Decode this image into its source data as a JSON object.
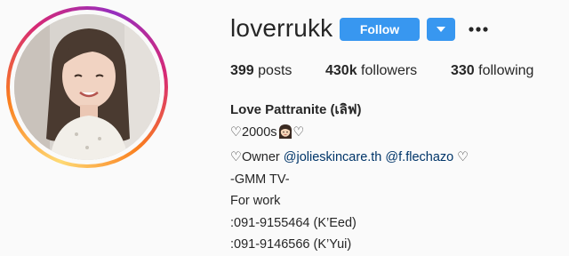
{
  "profile": {
    "username": "loverrukk",
    "follow_label": "Follow",
    "stats": {
      "posts_count": "399",
      "posts_label": "posts",
      "followers_count": "430k",
      "followers_label": "followers",
      "following_count": "330",
      "following_label": "following"
    },
    "full_name": "Love Pattranite (เลิฟ)",
    "bio": {
      "line1_prefix": "♡2000s",
      "line1_suffix": "♡",
      "line2_prefix": "♡Owner ",
      "mention1": "@jolieskincare.th",
      "mention2": "@f.flechazo",
      "line2_suffix": " ♡",
      "line3": "-GMM TV-",
      "line4": "For work",
      "line5": ":091-9155464 (K’Eed)",
      "line6": ":091-9146566 (K’Yui)"
    }
  },
  "icons": {
    "dropdown": "chevron-down-icon",
    "more": "more-options-icon",
    "emoji": "woman-emoji-icon"
  },
  "colors": {
    "accent": "#3897f0",
    "link": "#003569",
    "text": "#262626",
    "background": "#fafafa"
  }
}
